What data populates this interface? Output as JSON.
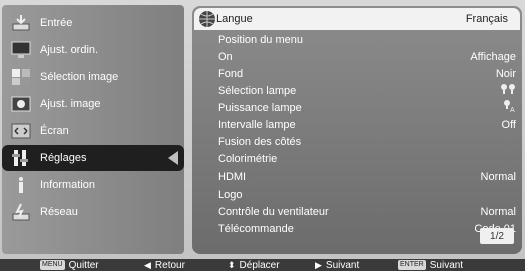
{
  "sidebar": {
    "items": [
      {
        "label": "Entrée",
        "icon": "input-icon"
      },
      {
        "label": "Ajust. ordin.",
        "icon": "computer-icon"
      },
      {
        "label": "Sélection image",
        "icon": "image-select-icon"
      },
      {
        "label": "Ajust. image",
        "icon": "image-adjust-icon"
      },
      {
        "label": "Écran",
        "icon": "screen-icon"
      },
      {
        "label": "Réglages",
        "icon": "settings-icon",
        "active": true
      },
      {
        "label": "Information",
        "icon": "information-icon"
      },
      {
        "label": "Réseau",
        "icon": "network-icon"
      }
    ]
  },
  "menu": {
    "rows": [
      {
        "label": "Langue",
        "value": "Français"
      },
      {
        "label": "Position du menu",
        "value": ""
      },
      {
        "label": "On",
        "value": "Affichage"
      },
      {
        "label": "Fond",
        "value": "Noir"
      },
      {
        "label": "Sélection lampe",
        "value": ""
      },
      {
        "label": "Puissance lampe",
        "value": ""
      },
      {
        "label": "Intervalle lampe",
        "value": "Off"
      },
      {
        "label": "Fusion des côtés",
        "value": ""
      },
      {
        "label": "Colorimétrie",
        "value": ""
      },
      {
        "label": "HDMI",
        "value": "Normal"
      },
      {
        "label": "Logo",
        "value": ""
      },
      {
        "label": "Contrôle du ventilateur",
        "value": "Normal"
      },
      {
        "label": "Télécommande",
        "value": "Code 01"
      }
    ],
    "page": "1/2"
  },
  "help": {
    "quit_key": "MENU",
    "quit": "Quitter",
    "back": "Retour",
    "move": "Déplacer",
    "next": "Suivant",
    "enter_key": "ENTER",
    "enter": "Suivant"
  },
  "colors": {
    "panel": "#7a7a7a",
    "selected_row": "#f2f2f2",
    "active_item": "#1f1f1f"
  }
}
